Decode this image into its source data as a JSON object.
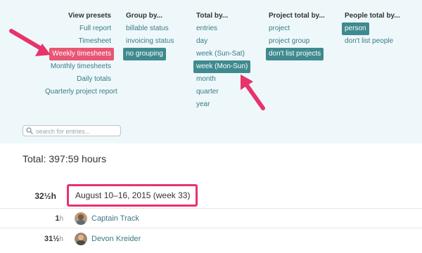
{
  "filters": {
    "view_presets": {
      "heading": "View presets",
      "options": [
        "Full report",
        "Timesheet",
        "Weekly timesheets",
        "Monthly timesheets",
        "Daily totals",
        "Quarterly project report"
      ],
      "selected": "Weekly timesheets"
    },
    "group_by": {
      "heading": "Group by...",
      "options": [
        "billable status",
        "invoicing status",
        "no grouping"
      ],
      "selected": "no grouping"
    },
    "total_by": {
      "heading": "Total by...",
      "options": [
        "entries",
        "day",
        "week (Sun-Sat)",
        "week (Mon-Sun)",
        "month",
        "quarter",
        "year"
      ],
      "selected": "week (Mon-Sun)"
    },
    "project_total_by": {
      "heading": "Project total by...",
      "options": [
        "project",
        "project group",
        "don't list projects"
      ],
      "selected": "don't list projects"
    },
    "people_total_by": {
      "heading": "People total by...",
      "options": [
        "person",
        "don't list people"
      ],
      "selected": "person"
    }
  },
  "search": {
    "placeholder": "search for entries..."
  },
  "summary": {
    "total": "Total: 397:59 hours"
  },
  "week_group": {
    "hours": "32½h",
    "label": "August 10–16, 2015 (week 33)"
  },
  "people": [
    {
      "hours": "1",
      "unit": "h",
      "name": "Captain Track"
    },
    {
      "hours": "31½",
      "unit": "h",
      "name": "Devon Kreider"
    }
  ],
  "colors": {
    "preset_highlight": "#e95574",
    "option_highlight": "#3f8a8f",
    "annotation": "#e8336b",
    "panel_bg": "#eef8fa"
  }
}
